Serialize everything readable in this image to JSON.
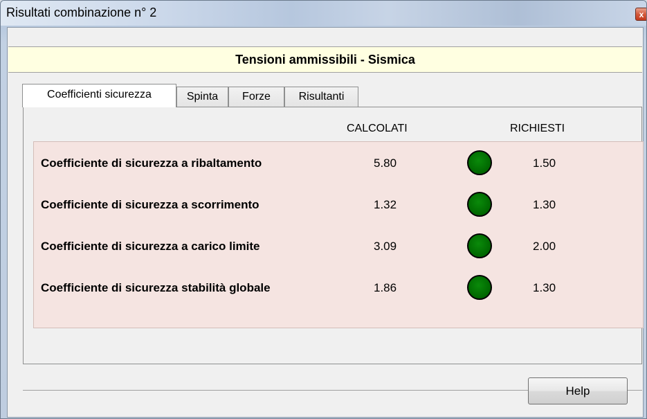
{
  "window": {
    "title": "Risultati combinazione n° 2",
    "close_glyph": "x"
  },
  "banner": {
    "text": "Tensioni ammissibili - Sismica"
  },
  "tabs": [
    {
      "label": "Coefficienti sicurezza",
      "active": true
    },
    {
      "label": "Spinta",
      "active": false
    },
    {
      "label": "Forze",
      "active": false
    },
    {
      "label": "Risultanti",
      "active": false
    }
  ],
  "columns": {
    "calcolati": "CALCOLATI",
    "richiesti": "RICHIESTI"
  },
  "rows": [
    {
      "label": "Coefficiente di sicurezza a ribaltamento",
      "calcolato": "5.80",
      "richiesto": "1.50",
      "status_color": "#006600"
    },
    {
      "label": "Coefficiente di sicurezza a scorrimento",
      "calcolato": "1.32",
      "richiesto": "1.30",
      "status_color": "#006600"
    },
    {
      "label": "Coefficiente di sicurezza a carico limite",
      "calcolato": "3.09",
      "richiesto": "2.00",
      "status_color": "#006600"
    },
    {
      "label": "Coefficiente di sicurezza stabilità globale",
      "calcolato": "1.86",
      "richiesto": "1.30",
      "status_color": "#006600"
    }
  ],
  "buttons": {
    "help": "Help"
  }
}
